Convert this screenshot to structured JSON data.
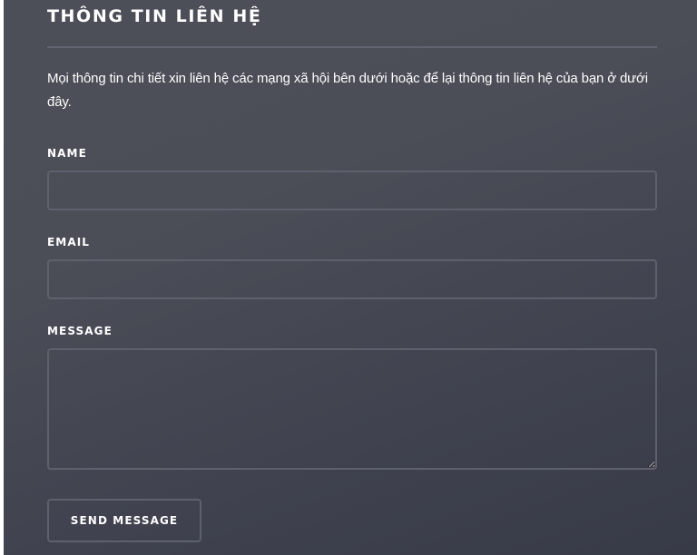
{
  "contact": {
    "title": "THÔNG TIN LIÊN HỆ",
    "intro": "Mọi thông tin chi tiết xin liên hệ các mạng xã hội bên dưới hoặc để lại thông tin liên hệ của bạn ở dưới đây.",
    "fields": {
      "name": {
        "label": "NAME",
        "value": ""
      },
      "email": {
        "label": "EMAIL",
        "value": ""
      },
      "message": {
        "label": "MESSAGE",
        "value": ""
      }
    },
    "submit_label": "SEND MESSAGE"
  },
  "colors": {
    "panel_top": "#4c4e58",
    "panel_bottom": "#373a47",
    "text": "#ffffff",
    "field_border": "#5e616d",
    "rule": "#626571"
  }
}
